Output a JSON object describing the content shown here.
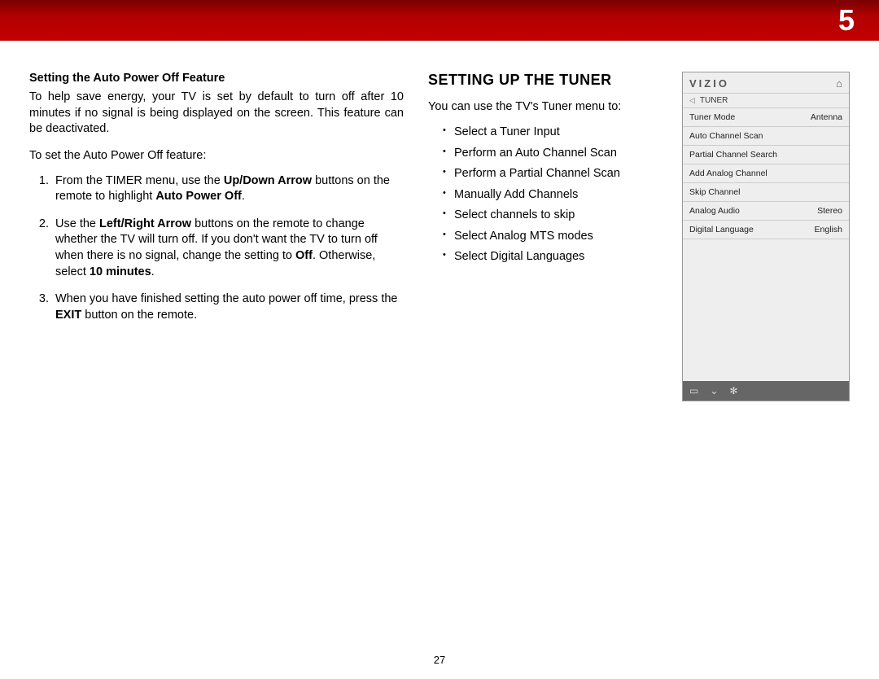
{
  "chapter_number": "5",
  "page_number": "27",
  "left": {
    "heading": "Setting the Auto Power Off Feature",
    "intro_para": "To help save energy, your TV is set by default to turn off after 10 minutes if no signal is being displayed on the screen. This feature can be deactivated.",
    "lead_in": "To set the Auto Power Off feature:",
    "step1_pre": "From the TIMER menu, use the ",
    "step1_bold1": "Up/Down Arrow",
    "step1_mid": " buttons on the remote to highlight ",
    "step1_bold2": "Auto Power Off",
    "step1_post": ".",
    "step2_pre": "Use the ",
    "step2_bold1": "Left/Right Arrow",
    "step2_mid": "  buttons on the remote to change whether the TV will turn off.  If you don't want the TV to turn off when there is no signal, change the setting to ",
    "step2_bold2": "Off",
    "step2_mid2": ". Otherwise, select ",
    "step2_bold3": "10 minutes",
    "step2_post": ".",
    "step3_pre": "When you have finished setting the auto power off time, press the ",
    "step3_bold1": "EXIT",
    "step3_post": " button on the remote."
  },
  "right": {
    "section_title": "SETTING UP THE TUNER",
    "intro": "You can use the TV's Tuner menu to:",
    "items": [
      "Select a Tuner Input",
      "Perform an Auto Channel Scan",
      "Perform a Partial Channel Scan",
      "Manually Add Channels",
      "Select channels to skip",
      "Select Analog MTS modes",
      "Select Digital Languages"
    ]
  },
  "panel": {
    "brand": "VIZIO",
    "breadcrumb": "TUNER",
    "rows": [
      {
        "label": "Tuner Mode",
        "value": "Antenna"
      },
      {
        "label": "Auto Channel Scan",
        "value": ""
      },
      {
        "label": "Partial Channel Search",
        "value": ""
      },
      {
        "label": "Add Analog Channel",
        "value": ""
      },
      {
        "label": "Skip Channel",
        "value": ""
      },
      {
        "label": "Analog Audio",
        "value": "Stereo"
      },
      {
        "label": "Digital Language",
        "value": "English"
      }
    ]
  }
}
